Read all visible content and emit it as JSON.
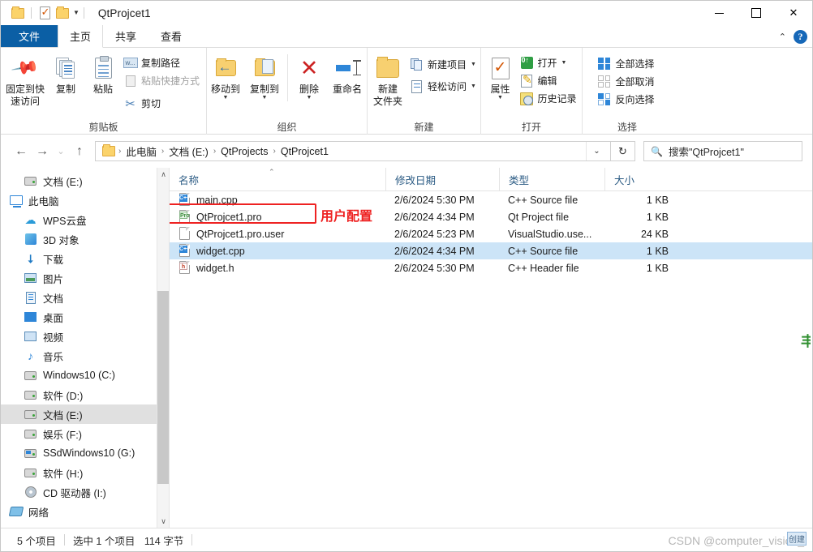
{
  "window": {
    "title": "QtProjcet1",
    "quick_access": [
      "folder-icon",
      "properties-icon",
      "folder-icon"
    ],
    "controls": {
      "minimize": "minimize-icon",
      "maximize": "maximize-icon",
      "close": "✕"
    }
  },
  "tabs": [
    {
      "id": "file",
      "label": "文件"
    },
    {
      "id": "home",
      "label": "主页"
    },
    {
      "id": "share",
      "label": "共享"
    },
    {
      "id": "view",
      "label": "查看"
    }
  ],
  "ribbon_right": {
    "collapse": "⌃",
    "help": "?"
  },
  "ribbon": {
    "groups": [
      {
        "name": "clipboard",
        "label": "剪贴板",
        "big": [
          {
            "name": "pin-to-quick-access",
            "label": "固定到快\n速访问",
            "icon": "pin-icon"
          },
          {
            "name": "copy",
            "label": "复制",
            "icon": "copy-icon"
          },
          {
            "name": "paste",
            "label": "粘贴",
            "icon": "clipboard-icon"
          }
        ],
        "small": [
          {
            "name": "copy-path",
            "label": "复制路径",
            "icon": "copy-path-icon",
            "dim": false
          },
          {
            "name": "paste-shortcut",
            "label": "粘贴快捷方式",
            "icon": "paste-shortcut-icon",
            "dim": true
          },
          {
            "name": "cut",
            "label": "剪切",
            "icon": "scissors-icon",
            "dim": false
          }
        ]
      },
      {
        "name": "organize",
        "label": "组织",
        "big": [
          {
            "name": "move-to",
            "label": "移动到",
            "icon": "folder-arrow-icon",
            "caret": true
          },
          {
            "name": "copy-to",
            "label": "复制到",
            "icon": "folder-copy-icon",
            "caret": true
          },
          {
            "name": "delete",
            "label": "删除",
            "icon": "delete-x-icon",
            "caret": true
          },
          {
            "name": "rename",
            "label": "重命名",
            "icon": "rename-icon",
            "caret": false
          }
        ]
      },
      {
        "name": "new",
        "label": "新建",
        "big": [
          {
            "name": "new-folder",
            "label": "新建\n文件夹",
            "icon": "folder-icon"
          }
        ],
        "small": [
          {
            "name": "new-item",
            "label": "新建项目",
            "icon": "new-item-icon",
            "caret": true
          },
          {
            "name": "easy-access",
            "label": "轻松访问",
            "icon": "easy-access-icon",
            "caret": true
          }
        ]
      },
      {
        "name": "open",
        "label": "打开",
        "big": [
          {
            "name": "properties",
            "label": "属性",
            "icon": "properties-icon",
            "caret": true
          }
        ],
        "small": [
          {
            "name": "open",
            "label": "打开",
            "icon": "open-icon",
            "caret": true
          },
          {
            "name": "edit",
            "label": "编辑",
            "icon": "edit-icon"
          },
          {
            "name": "history",
            "label": "历史记录",
            "icon": "history-icon"
          }
        ]
      },
      {
        "name": "select",
        "label": "选择",
        "small": [
          {
            "name": "select-all",
            "label": "全部选择",
            "icon": "select-all-icon"
          },
          {
            "name": "select-none",
            "label": "全部取消",
            "icon": "select-none-icon"
          },
          {
            "name": "invert-selection",
            "label": "反向选择",
            "icon": "invert-selection-icon"
          }
        ]
      }
    ]
  },
  "address": {
    "back": "←",
    "forward": "→",
    "recent": "⌄",
    "up": "↑",
    "breadcrumbs": [
      "此电脑",
      "文档 (E:)",
      "QtProjects",
      "QtProjcet1"
    ],
    "separator": "›",
    "dropdown": "⌄",
    "refresh": "↻"
  },
  "search": {
    "placeholder": "搜索\"QtProjcet1\"",
    "icon": "search-icon"
  },
  "navpane": {
    "items": [
      {
        "name": "documents-e",
        "label": "文档 (E:)",
        "icon": "drive-icon",
        "indent": 1,
        "selected": false
      },
      {
        "name": "this-pc",
        "label": "此电脑",
        "icon": "pc-icon",
        "indent": 0,
        "selected": false
      },
      {
        "name": "wps-cloud",
        "label": "WPS云盘",
        "icon": "cloud-icon",
        "indent": 1,
        "selected": false
      },
      {
        "name": "3d-objects",
        "label": "3D 对象",
        "icon": "cube-icon",
        "indent": 1,
        "selected": false
      },
      {
        "name": "downloads",
        "label": "下载",
        "icon": "download-icon",
        "indent": 1,
        "selected": false
      },
      {
        "name": "pictures",
        "label": "图片",
        "icon": "picture-icon",
        "indent": 1,
        "selected": false
      },
      {
        "name": "documents",
        "label": "文档",
        "icon": "document-icon",
        "indent": 1,
        "selected": false
      },
      {
        "name": "desktop",
        "label": "桌面",
        "icon": "desktop-icon",
        "indent": 1,
        "selected": false
      },
      {
        "name": "videos",
        "label": "视频",
        "icon": "video-icon",
        "indent": 1,
        "selected": false
      },
      {
        "name": "music",
        "label": "音乐",
        "icon": "music-icon",
        "indent": 1,
        "selected": false
      },
      {
        "name": "windows10-c",
        "label": "Windows10 (C:)",
        "icon": "drive-icon",
        "indent": 1,
        "selected": false
      },
      {
        "name": "software-d",
        "label": "软件 (D:)",
        "icon": "drive-icon",
        "indent": 1,
        "selected": false
      },
      {
        "name": "documents-e2",
        "label": "文档 (E:)",
        "icon": "drive-icon",
        "indent": 1,
        "selected": true
      },
      {
        "name": "entertainment-f",
        "label": "娱乐 (F:)",
        "icon": "drive-icon",
        "indent": 1,
        "selected": false
      },
      {
        "name": "ssdwindows10-g",
        "label": "SSdWindows10 (G:)",
        "icon": "ssd-icon",
        "indent": 1,
        "selected": false
      },
      {
        "name": "software-h",
        "label": "软件 (H:)",
        "icon": "drive-icon",
        "indent": 1,
        "selected": false
      },
      {
        "name": "cd-drive-i",
        "label": "CD 驱动器 (I:)",
        "icon": "cd-icon",
        "indent": 1,
        "selected": false
      },
      {
        "name": "network",
        "label": "网络",
        "icon": "network-icon",
        "indent": 0,
        "selected": false
      }
    ]
  },
  "filelist": {
    "columns": [
      {
        "key": "name",
        "label": "名称",
        "sorted": true,
        "sort_arrow": "⌃"
      },
      {
        "key": "date",
        "label": "修改日期"
      },
      {
        "key": "type",
        "label": "类型"
      },
      {
        "key": "size",
        "label": "大小"
      }
    ],
    "rows": [
      {
        "name": "main.cpp",
        "date": "2/6/2024 5:30 PM",
        "type": "C++ Source file",
        "size": "1 KB",
        "icon": "cpp-file-icon",
        "tag": "C++",
        "selected": false
      },
      {
        "name": "QtProjcet1.pro",
        "date": "2/6/2024 4:34 PM",
        "type": "Qt Project file",
        "size": "1 KB",
        "icon": "pro-file-icon",
        "tag": "Pro",
        "selected": false
      },
      {
        "name": "QtProjcet1.pro.user",
        "date": "2/6/2024 5:23 PM",
        "type": "VisualStudio.use...",
        "size": "24 KB",
        "icon": "generic-file-icon",
        "tag": "",
        "selected": false
      },
      {
        "name": "widget.cpp",
        "date": "2/6/2024 4:34 PM",
        "type": "C++ Source file",
        "size": "1 KB",
        "icon": "cpp-file-icon",
        "tag": "C++",
        "selected": true
      },
      {
        "name": "widget.h",
        "date": "2/6/2024 5:30 PM",
        "type": "C++ Header file",
        "size": "1 KB",
        "icon": "h-file-icon",
        "tag": "h",
        "selected": false
      }
    ]
  },
  "annotation": {
    "label": "用户配置",
    "color": "#ee2222"
  },
  "statusbar": {
    "item_count": "5 个项目",
    "selection": "选中 1 个项目",
    "selection_size": "114 字节"
  },
  "watermark": {
    "text": "CSDN @computer_vision_",
    "chip": "创建"
  },
  "edge_glyph": "丰"
}
